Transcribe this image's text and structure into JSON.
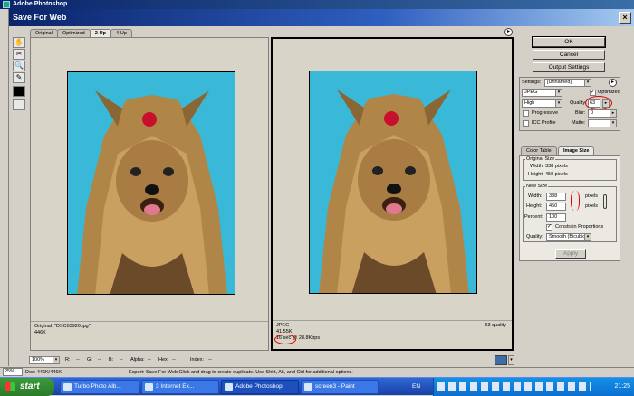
{
  "photoshop": {
    "title": "Adobe Photoshop"
  },
  "dialog": {
    "title": "Save For Web",
    "close_glyph": "×"
  },
  "tabs": [
    "Original",
    "Optimized",
    "2-Up",
    "4-Up"
  ],
  "tools": [
    "✋",
    "✂",
    "🔍",
    "✎"
  ],
  "left_pane": {
    "line1": "Original: \"DSC03920.jpg\"",
    "line2": "446K"
  },
  "right_pane": {
    "line1": "JPEG",
    "line2": "41.55K",
    "line3": "16 sec @ 28.8Kbps",
    "quality": "63 quality"
  },
  "panel": {
    "ok": "OK",
    "cancel": "Cancel",
    "output": "Output Settings",
    "settings_label": "Settings:",
    "settings_value": "[Unnamed]",
    "format": "JPEG",
    "optimized": "Optimized",
    "compression": "High",
    "quality_label": "Quality:",
    "quality_value": "63",
    "progressive": "Progressive",
    "blur_label": "Blur:",
    "blur_value": "0",
    "icc": "ICC Profile",
    "matte_label": "Matte:",
    "tab_color": "Color Table",
    "tab_size": "Image Size",
    "orig_size": "Original Size",
    "orig_w": "Width: 338 pixels",
    "orig_h": "Height: 450 pixels",
    "new_size": "New Size",
    "width_label": "Width:",
    "width_value": "338",
    "height_label": "Height:",
    "height_value": "450",
    "pixels": "pixels",
    "percent_label": "Percent:",
    "percent_value": "100",
    "constrain": "Constrain Proportions",
    "interp_label": "Quality:",
    "interp_value": "Smooth (Bicubic)",
    "apply": "Apply"
  },
  "status": {
    "zoom": "100%",
    "r": "R:",
    "r_val": "--",
    "g": "G:",
    "g_val": "--",
    "b": "B:",
    "b_val": "--",
    "alpha": "Alpha:",
    "alpha_val": "--",
    "hex": "Hex:",
    "hex_val": "--",
    "index": "Index:",
    "index_val": "--"
  },
  "ps_status": {
    "zoom": "25%",
    "doc": "Doc: 446K/446K",
    "msg": "Export: Save For Web   Click and drag to create duplicate. Use Shift, Alt, and Ctrl for additional options."
  },
  "taskbar": {
    "start": "start",
    "items": [
      "Turbo Photo Alb...",
      "3 Internet Ex...",
      "Adobe Photoshop",
      "screen3 - Paint"
    ],
    "lang": "EN",
    "clock": "21:25"
  }
}
